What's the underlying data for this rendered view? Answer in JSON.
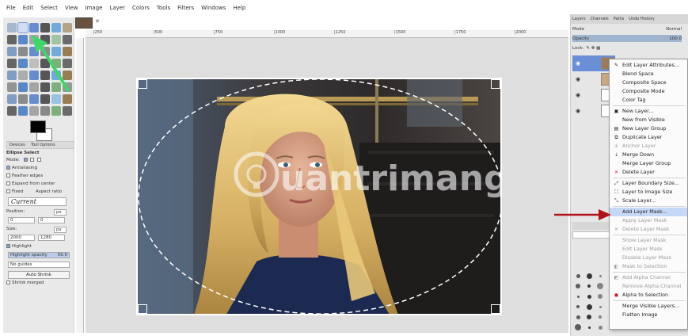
{
  "menu": [
    "File",
    "Edit",
    "Select",
    "View",
    "Image",
    "Layer",
    "Colors",
    "Tools",
    "Filters",
    "Windows",
    "Help"
  ],
  "tool_options": {
    "tabs": [
      "Devices",
      "Tool Options"
    ],
    "title": "Ellipse Select",
    "mode_label": "Mode:",
    "antialiasing": "Antialiasing",
    "feather": "Feather edges",
    "expand": "Expand from center",
    "fixed": "Fixed",
    "aspect": "Aspect ratio",
    "current": "Current",
    "position_label": "Position:",
    "position_unit": "px",
    "pos_x": "0",
    "pos_y": "0",
    "size_label": "Size:",
    "size_unit": "px",
    "size_w": "2000",
    "size_h": "1280",
    "highlight": "Highlight",
    "highlight_opacity": "Highlight opacity",
    "highlight_value": "50.0",
    "guides": "No guides",
    "auto_shrink": "Auto Shrink",
    "shrink_merged": "Shrink merged"
  },
  "ruler_ticks": [
    "|250",
    "|500",
    "|750",
    "|1000",
    "|1250",
    "|1500",
    "|1750",
    "|2000"
  ],
  "dock": {
    "tabs": [
      "Layers",
      "Channels",
      "Paths",
      "Undo History"
    ],
    "mode_label": "Mode",
    "mode_value": "Normal",
    "opacity_label": "Opacity",
    "opacity_value": "100.0",
    "lock_label": "Lock:"
  },
  "context_menu": [
    {
      "label": "Edit Layer Attributes...",
      "state": "enabled",
      "icon": "edit-icon"
    },
    {
      "label": "Blend Space",
      "state": "enabled",
      "icon": ""
    },
    {
      "label": "Composite Space",
      "state": "enabled",
      "icon": ""
    },
    {
      "label": "Composite Mode",
      "state": "enabled",
      "icon": ""
    },
    {
      "label": "Color Tag",
      "state": "enabled",
      "icon": ""
    },
    {
      "label": "New Layer...",
      "state": "enabled",
      "icon": "new-layer-icon"
    },
    {
      "label": "New from Visible",
      "state": "enabled",
      "icon": ""
    },
    {
      "label": "New Layer Group",
      "state": "enabled",
      "icon": "folder-icon"
    },
    {
      "label": "Duplicate Layer",
      "state": "enabled",
      "icon": "duplicate-icon"
    },
    {
      "label": "Anchor Layer",
      "state": "disabled",
      "icon": "anchor-icon"
    },
    {
      "label": "Merge Down",
      "state": "enabled",
      "icon": "merge-icon"
    },
    {
      "label": "Merge Layer Group",
      "state": "enabled",
      "icon": ""
    },
    {
      "label": "Delete Layer",
      "state": "enabled",
      "icon": "delete-icon"
    },
    {
      "label": "Layer Boundary Size...",
      "state": "enabled",
      "icon": "resize-icon"
    },
    {
      "label": "Layer to Image Size",
      "state": "enabled",
      "icon": "fit-icon"
    },
    {
      "label": "Scale Layer...",
      "state": "enabled",
      "icon": "scale-icon"
    },
    {
      "label": "Add Layer Mask...",
      "state": "highlighted",
      "icon": ""
    },
    {
      "label": "Apply Layer Mask",
      "state": "disabled",
      "icon": ""
    },
    {
      "label": "Delete Layer Mask",
      "state": "disabled",
      "icon": "delete-icon"
    },
    {
      "label": "Show Layer Mask",
      "state": "disabled",
      "icon": ""
    },
    {
      "label": "Edit Layer Mask",
      "state": "disabled",
      "icon": ""
    },
    {
      "label": "Disable Layer Mask",
      "state": "disabled",
      "icon": ""
    },
    {
      "label": "Mask to Selection",
      "state": "disabled",
      "icon": "mask-icon"
    },
    {
      "label": "Add Alpha Channel",
      "state": "disabled",
      "icon": "alpha-icon"
    },
    {
      "label": "Remove Alpha Channel",
      "state": "disabled",
      "icon": ""
    },
    {
      "label": "Alpha to Selection",
      "state": "enabled",
      "icon": "alpha-selection-icon"
    },
    {
      "label": "Merge Visible Layers...",
      "state": "enabled",
      "icon": ""
    },
    {
      "label": "Flatten Image",
      "state": "enabled",
      "icon": ""
    }
  ],
  "watermark": "uantrimang",
  "colors": {
    "accent": "#c5d8f5",
    "red_arrow": "#b0141a",
    "green_arrow": "#3ed66a"
  }
}
